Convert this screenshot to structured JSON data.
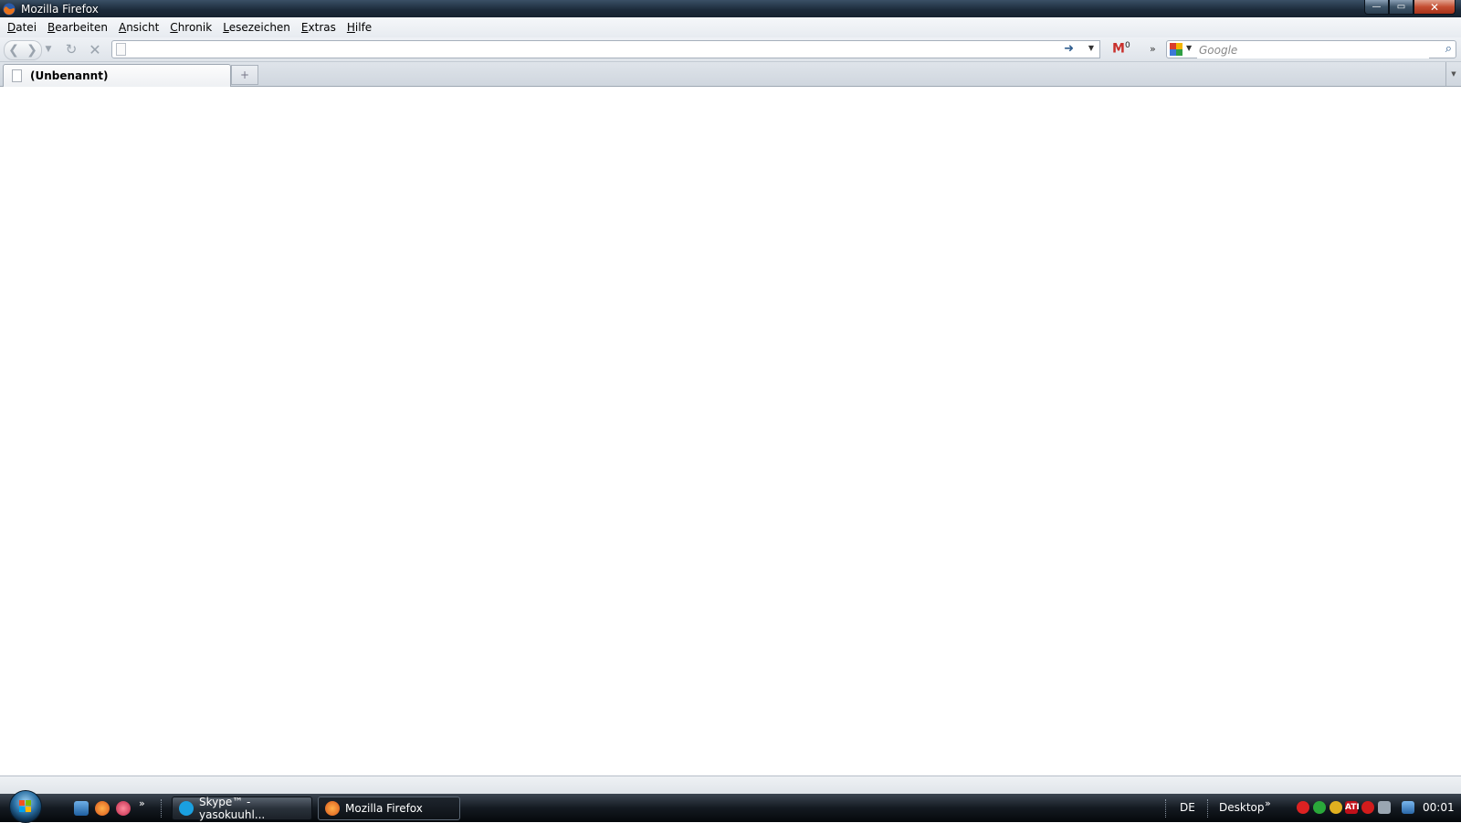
{
  "window": {
    "title": "Mozilla Firefox",
    "controls": {
      "minimize": "—",
      "maximize": "▭",
      "close": "✕"
    }
  },
  "menubar": {
    "items": [
      {
        "label": "Datei"
      },
      {
        "label": "Bearbeiten"
      },
      {
        "label": "Ansicht"
      },
      {
        "label": "Chronik"
      },
      {
        "label": "Lesezeichen"
      },
      {
        "label": "Extras"
      },
      {
        "label": "Hilfe"
      }
    ]
  },
  "navbar": {
    "url_value": "",
    "gmail_count": "0",
    "search": {
      "placeholder": "Google",
      "engine_icon": "google-icon"
    },
    "overflow": "»",
    "icons": {
      "back": "back-arrow-icon",
      "forward": "forward-arrow-icon",
      "reload": "reload-icon",
      "stop": "stop-icon",
      "go": "go-arrow-icon",
      "search": "magnifier-icon"
    }
  },
  "tabs": {
    "items": [
      {
        "label": "(Unbenannt)",
        "active": true
      }
    ],
    "new_tab": "+"
  },
  "taskbar": {
    "quicklaunch_chevron": "»",
    "buttons": [
      {
        "label": "Skype™ - yasokuuhl...",
        "active": false,
        "icon_color": "#1aa0e0"
      },
      {
        "label": "Mozilla Firefox",
        "active": true,
        "icon_color": "#e86a1a"
      }
    ],
    "tray": {
      "language": "DE",
      "toolbar_label": "Desktop",
      "toolbar_chevron": "»",
      "clock": "00:01",
      "ati_label": "ATI"
    }
  },
  "colors": {
    "titlebar": "#1d2c3c",
    "link_blue": "#2f5d8f",
    "gmail_red": "#c9302c",
    "taskbar": "#141a21"
  }
}
